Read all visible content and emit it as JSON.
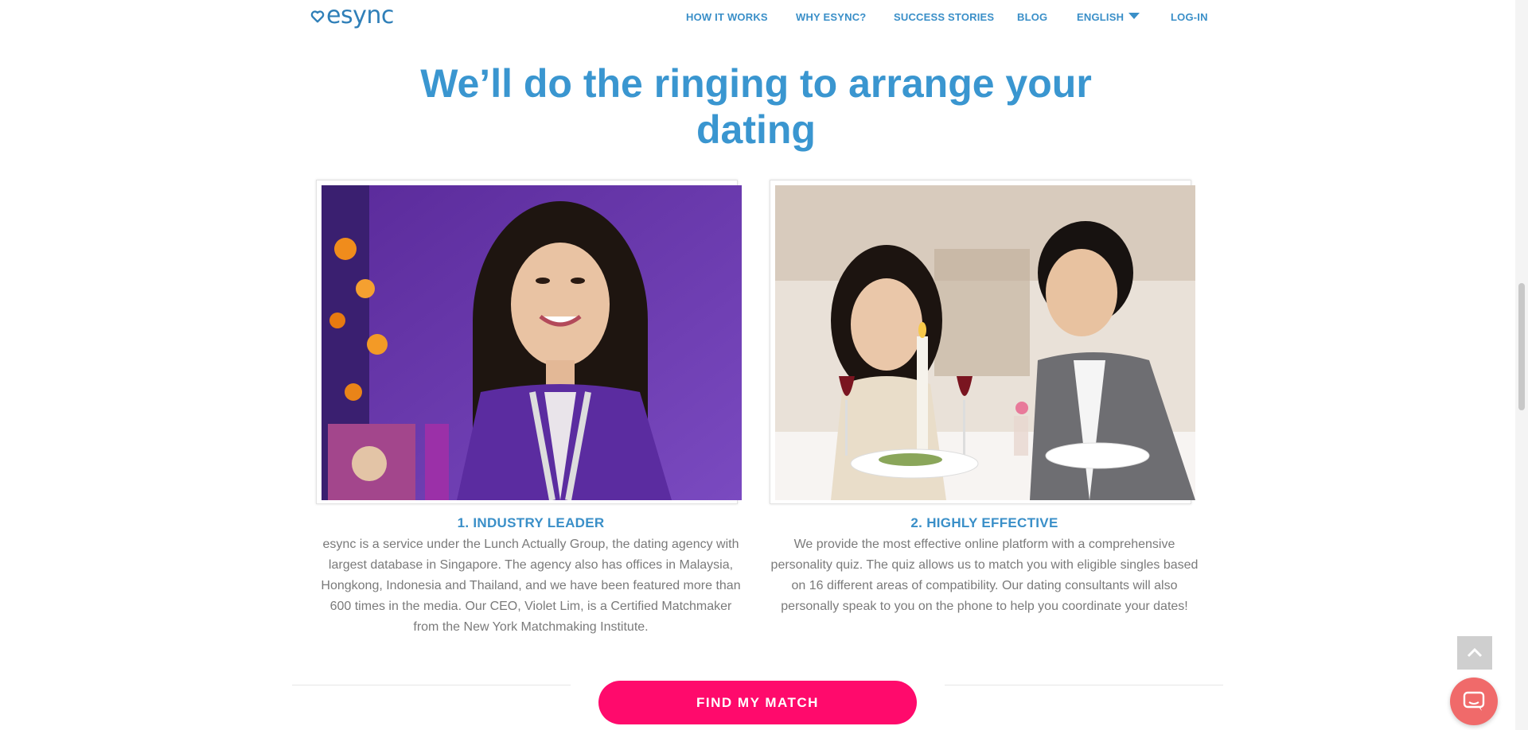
{
  "header": {
    "logo_text": "esync",
    "nav": [
      {
        "label": "HOW IT WORKS"
      },
      {
        "label": "WHY ESYNC?"
      },
      {
        "label": "SUCCESS STORIES"
      },
      {
        "label": "BLOG"
      },
      {
        "label": "ENGLISH"
      },
      {
        "label": "LOG-IN"
      }
    ]
  },
  "hero": {
    "line1": "We’ll do the ringing to arrange your",
    "line2": "dating"
  },
  "features": [
    {
      "title": "1. INDUSTRY LEADER",
      "text": "esync is a service under the Lunch Actually Group, the dating agency with largest database in Singapore. The agency also has offices in Malaysia, Hongkong, Indonesia and Thailand, and we have been featured more than 600 times in the media. Our CEO, Violet Lim, is a Certified Matchmaker from the New York Matchmaking Institute."
    },
    {
      "title": "2. HIGHLY EFFECTIVE",
      "text": "We provide the most effective online platform with a comprehensive personality quiz. The quiz allows us to match you with eligible singles based on 16 different areas of compatibility. Our dating consultants will also personally speak to you on the phone to help you coordinate your dates!"
    }
  ],
  "cta": {
    "label": "FIND MY MATCH"
  },
  "colors": {
    "brand_blue": "#3a96d0",
    "cta_pink": "#ff0a6c",
    "chat_bubble": "#f06a6a"
  },
  "icons": [
    "heart-logo-icon",
    "caret-down-icon",
    "back-to-top-icon",
    "chat-icon"
  ]
}
